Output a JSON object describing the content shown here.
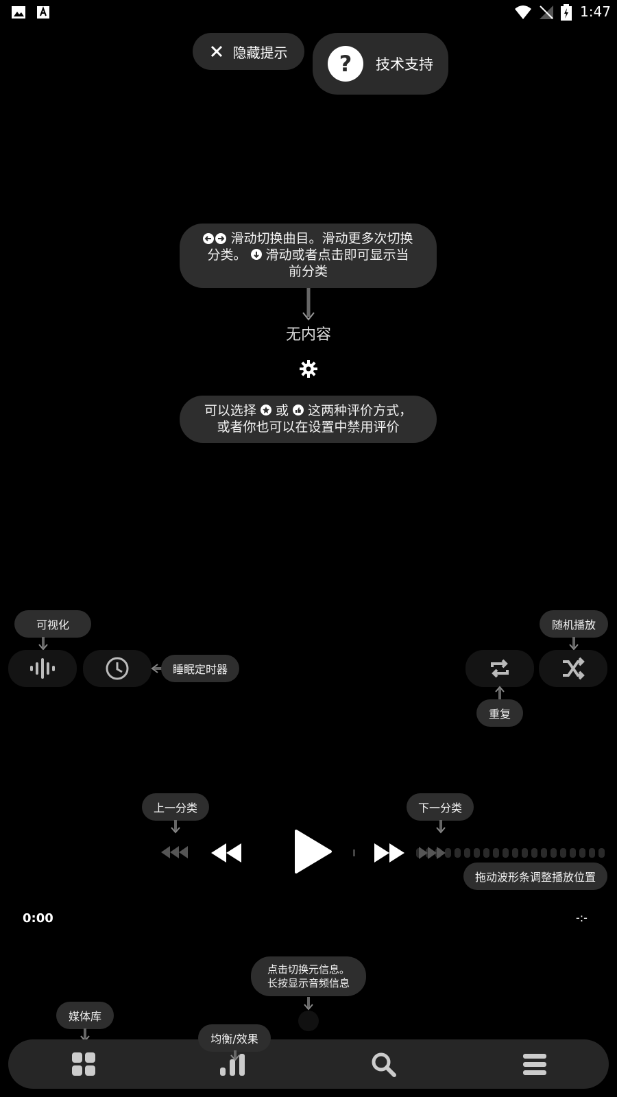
{
  "status_bar": {
    "time": "1:47"
  },
  "top": {
    "hide_tips_label": "隐藏提示",
    "support_label": "技术支持"
  },
  "center": {
    "swipe_tip_line1": "滑动切换曲目。滑动更多次切换",
    "swipe_tip_line2a": "分类。",
    "swipe_tip_line2b": "滑动或者点击即可显示当",
    "swipe_tip_line3": "前分类",
    "no_content": "无内容",
    "rating_tip_a": "可以选择",
    "rating_tip_b": "或",
    "rating_tip_c": "这两种评价方式，",
    "rating_tip_line2": "或者你也可以在设置中禁用评价"
  },
  "controls": {
    "visualizer_tip": "可视化",
    "sleep_timer_tip": "睡眠定时器",
    "shuffle_tip": "随机播放",
    "repeat_tip": "重复",
    "prev_category_tip": "上一分类",
    "next_category_tip": "下一分类",
    "waveform_tip": "拖动波形条调整播放位置"
  },
  "playback": {
    "elapsed": "0:00",
    "remaining": "-:-"
  },
  "meta_tip_line1": "点击切换元信息。",
  "meta_tip_line2": "长按显示音频信息",
  "bottom_nav": {
    "library_tip": "媒体库",
    "eq_tip": "均衡/效果"
  },
  "icons": [
    "image-icon",
    "font-icon",
    "wifi-icon",
    "signal-icon",
    "battery-icon",
    "close-icon",
    "help-icon",
    "gear-icon",
    "visualizer-icon",
    "clock-icon",
    "repeat-icon",
    "shuffle-icon",
    "rewind-icon",
    "play-icon",
    "fast-forward-icon",
    "grid-icon",
    "equalizer-icon",
    "search-icon",
    "menu-icon"
  ]
}
